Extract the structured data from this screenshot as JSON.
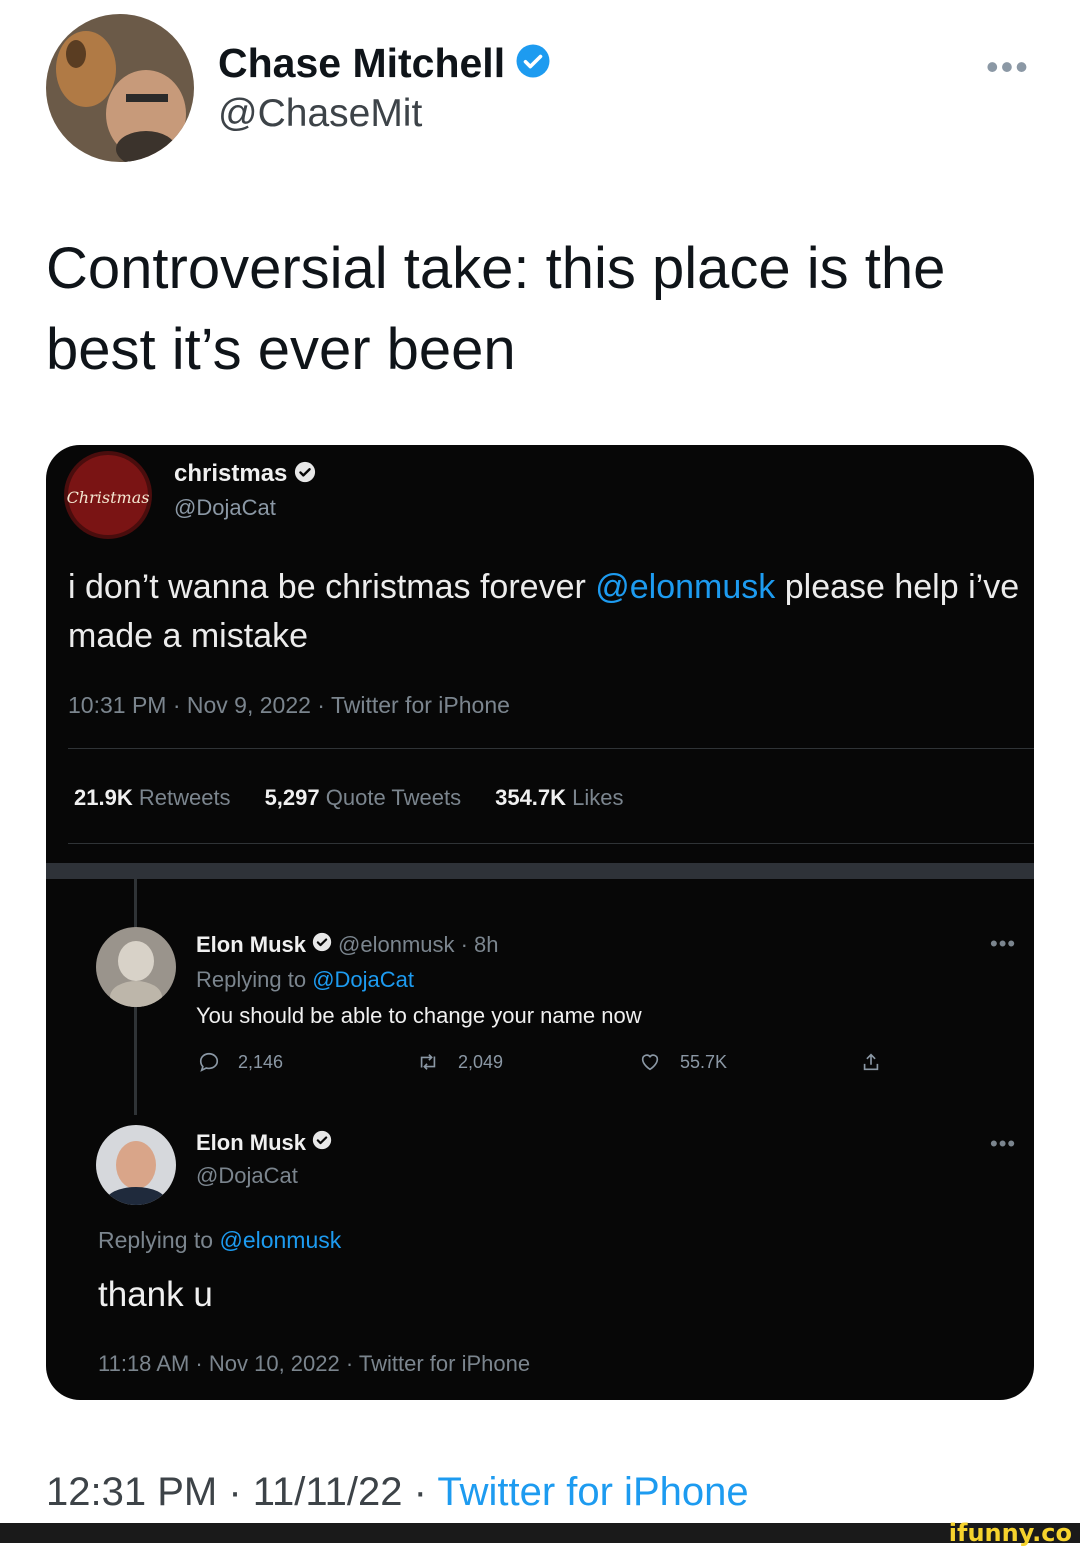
{
  "tweet": {
    "author_name": "Chase Mitchell",
    "author_handle": "@ChaseMit",
    "more_icon": "•••",
    "text": "Controversial take: this place is the best it’s ever been",
    "footer_time": "12:31 PM · 11/11/22 · ",
    "footer_source": "Twitter for iPhone",
    "verified_color": "#1d9bf0"
  },
  "embedded": {
    "original": {
      "avatar_text": "Christmas",
      "name": "christmas",
      "handle": "@DojaCat",
      "text_before": "i don’t wanna be christmas forever ",
      "mention": "@elonmusk",
      "text_after": " please help i’ve made a mistake",
      "meta": "10:31 PM · Nov 9, 2022 · Twitter for iPhone",
      "stats": [
        {
          "num": "21.9K",
          "label": "Retweets"
        },
        {
          "num": "5,297",
          "label": "Quote Tweets"
        },
        {
          "num": "354.7K",
          "label": "Likes"
        }
      ]
    },
    "reply1": {
      "name": "Elon Musk",
      "sub": "@elonmusk · 8h",
      "replying_label": "Replying to ",
      "replying_handle": "@DojaCat",
      "text": "You should be able to change your name now",
      "replies": "2,146",
      "retweets": "2,049",
      "likes": "55.7K",
      "more_icon": "•••"
    },
    "reply2": {
      "name": "Elon Musk",
      "handle": "@DojaCat",
      "replying_label": "Replying to ",
      "replying_handle": "@elonmusk",
      "text": "thank u",
      "meta": "11:18 AM · Nov 10, 2022 · Twitter for iPhone",
      "more_icon": "•••"
    }
  },
  "watermark": "ifunny.co"
}
